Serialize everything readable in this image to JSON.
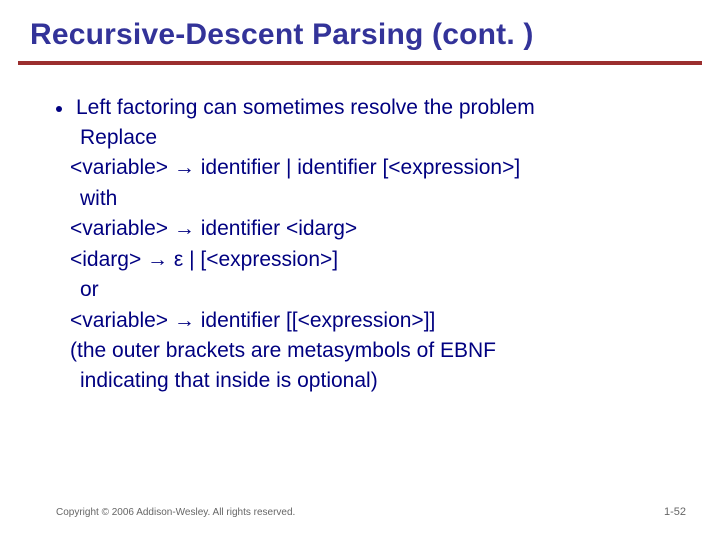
{
  "title": "Recursive-Descent Parsing (cont. )",
  "bullet": {
    "lead": "Left factoring can sometimes resolve the problem",
    "lines": {
      "replace": "Replace",
      "rule1": "<variable> → identifier  |  identifier [<expression>]",
      "with": "with",
      "rule2": "<variable> → identifier <idarg>",
      "rule3": "<idarg> → ε   |  [<expression>]",
      "or": "or",
      "rule4": "<variable> → identifier [[<expression>]]",
      "note1": "(the outer brackets are metasymbols of EBNF",
      "note2": "indicating that inside is optional)"
    }
  },
  "footer": {
    "copyright": "Copyright © 2006 Addison-Wesley. All rights reserved.",
    "page": "1-52"
  }
}
